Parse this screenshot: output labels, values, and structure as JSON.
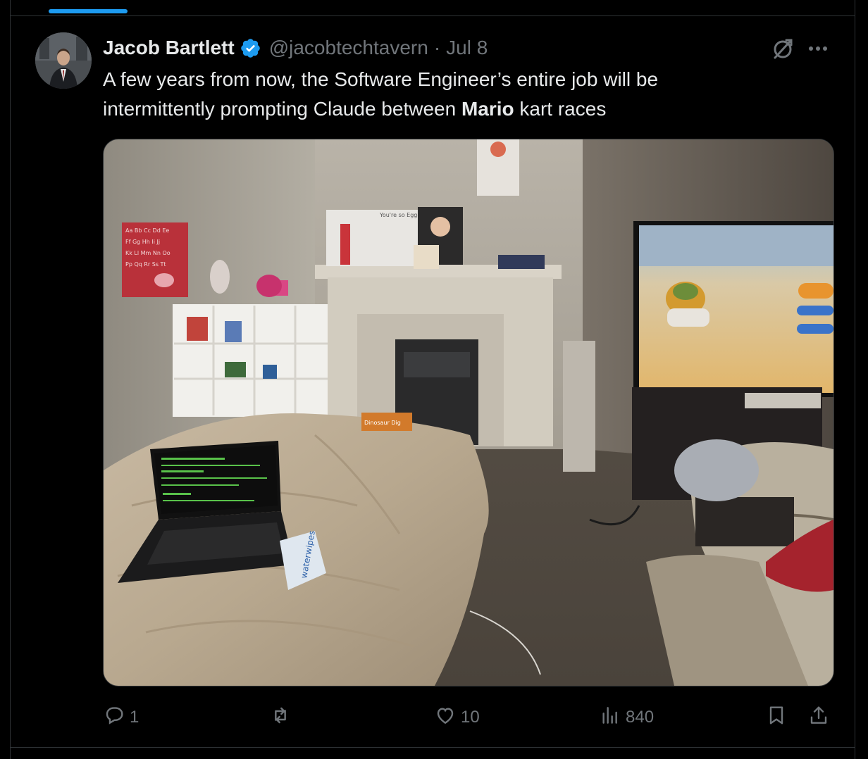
{
  "tweet": {
    "author_name": "Jacob Bartlett",
    "handle": "@jacobtechtavern",
    "separator": "·",
    "date": "Jul 8",
    "text_line1": "A few years from now, the Software Engineer’s entire job will be",
    "text_line2_before": "intermittently prompting Claude between ",
    "text_line2_bold": "Mario",
    "text_line2_after": " kart races"
  },
  "media": {
    "photo_text": {
      "alphabet_poster": [
        "Aa Bb Cc Dd Ee",
        "Ff Gg Hh Ii Jj",
        "Kk Ll Mm Nn Oo",
        "Pp Qq Rr Ss Tt"
      ],
      "note": "You're so Egg-cellent",
      "game_box": "Dinosaur Dig",
      "wipes": "waterwipes"
    }
  },
  "actions": {
    "replies": "1",
    "reposts": "",
    "likes": "10",
    "views": "840"
  },
  "colors": {
    "background": "#000000",
    "text": "#e7e9ea",
    "muted": "#71767b",
    "accent": "#1d9bf0",
    "border": "#2f3336"
  },
  "icons": [
    "verified-badge-icon",
    "grok-icon",
    "more-icon",
    "reply-icon",
    "repost-icon",
    "like-icon",
    "views-icon",
    "bookmark-icon",
    "share-icon"
  ]
}
